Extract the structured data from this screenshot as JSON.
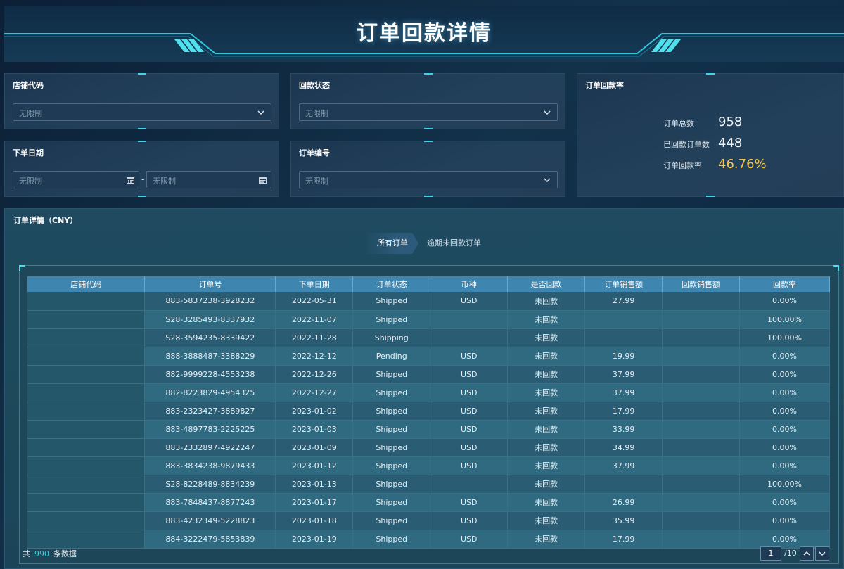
{
  "page": {
    "title": "订单回款详情"
  },
  "filters": {
    "store_code": {
      "label": "店铺代码",
      "placeholder": "无限制"
    },
    "payment_status": {
      "label": "回款状态",
      "placeholder": "无限制"
    },
    "order_date": {
      "label": "下单日期",
      "start_placeholder": "无限制",
      "end_placeholder": "无限制",
      "separator": "-"
    },
    "order_no": {
      "label": "订单编号",
      "placeholder": "无限制"
    }
  },
  "rate_panel": {
    "title": "订单回款率",
    "total_label": "订单总数",
    "total_value": "958",
    "paid_label": "已回款订单数",
    "paid_value": "448",
    "rate_label": "订单回款率",
    "rate_value": "46.76%"
  },
  "detail": {
    "title": "订单详情（CNY）",
    "tabs": [
      {
        "label": "所有订单"
      },
      {
        "label": "逾期未回款订单"
      }
    ],
    "columns": [
      "店铺代码",
      "订单号",
      "下单日期",
      "订单状态",
      "币种",
      "是否回款",
      "订单销售额",
      "回款销售额",
      "回款率"
    ],
    "rows": [
      {
        "store": "",
        "order_no": "883-5837238-3928232",
        "date": "2022-05-31",
        "status": "Shipped",
        "currency": "USD",
        "paid": "未回款",
        "sales": "27.99",
        "paid_sales": "",
        "rate": "0.00%"
      },
      {
        "store": "",
        "order_no": "S28-3285493-8337932",
        "date": "2022-11-07",
        "status": "Shipped",
        "currency": "",
        "paid": "未回款",
        "sales": "",
        "paid_sales": "",
        "rate": "100.00%"
      },
      {
        "store": "",
        "order_no": "S28-3594235-8339422",
        "date": "2022-11-28",
        "status": "Shipping",
        "currency": "",
        "paid": "未回款",
        "sales": "",
        "paid_sales": "",
        "rate": "100.00%"
      },
      {
        "store": "",
        "order_no": "888-3888487-3388229",
        "date": "2022-12-12",
        "status": "Pending",
        "currency": "USD",
        "paid": "未回款",
        "sales": "19.99",
        "paid_sales": "",
        "rate": "0.00%"
      },
      {
        "store": "",
        "order_no": "882-9999228-4553238",
        "date": "2022-12-26",
        "status": "Shipped",
        "currency": "USD",
        "paid": "未回款",
        "sales": "37.99",
        "paid_sales": "",
        "rate": "0.00%"
      },
      {
        "store": "",
        "order_no": "882-8223829-4954325",
        "date": "2022-12-27",
        "status": "Shipped",
        "currency": "USD",
        "paid": "未回款",
        "sales": "37.99",
        "paid_sales": "",
        "rate": "0.00%"
      },
      {
        "store": "",
        "order_no": "883-2323427-3889827",
        "date": "2023-01-02",
        "status": "Shipped",
        "currency": "USD",
        "paid": "未回款",
        "sales": "17.99",
        "paid_sales": "",
        "rate": "0.00%"
      },
      {
        "store": "",
        "order_no": "883-4897783-2225225",
        "date": "2023-01-03",
        "status": "Shipped",
        "currency": "USD",
        "paid": "未回款",
        "sales": "33.99",
        "paid_sales": "",
        "rate": "0.00%"
      },
      {
        "store": "",
        "order_no": "883-2332897-4922247",
        "date": "2023-01-09",
        "status": "Shipped",
        "currency": "USD",
        "paid": "未回款",
        "sales": "34.99",
        "paid_sales": "",
        "rate": "0.00%"
      },
      {
        "store": "",
        "order_no": "883-3834238-9879433",
        "date": "2023-01-12",
        "status": "Shipped",
        "currency": "USD",
        "paid": "未回款",
        "sales": "37.99",
        "paid_sales": "",
        "rate": "0.00%"
      },
      {
        "store": "",
        "order_no": "S28-8228489-8834239",
        "date": "2023-01-13",
        "status": "Shipped",
        "currency": "",
        "paid": "未回款",
        "sales": "",
        "paid_sales": "",
        "rate": "100.00%"
      },
      {
        "store": "",
        "order_no": "883-7848437-8877243",
        "date": "2023-01-17",
        "status": "Shipped",
        "currency": "USD",
        "paid": "未回款",
        "sales": "26.99",
        "paid_sales": "",
        "rate": "0.00%"
      },
      {
        "store": "",
        "order_no": "883-4232349-5228823",
        "date": "2023-01-18",
        "status": "Shipped",
        "currency": "USD",
        "paid": "未回款",
        "sales": "35.99",
        "paid_sales": "",
        "rate": "0.00%"
      },
      {
        "store": "",
        "order_no": "884-3222479-5853839",
        "date": "2023-01-19",
        "status": "Shipped",
        "currency": "USD",
        "paid": "未回款",
        "sales": "17.99",
        "paid_sales": "",
        "rate": "0.00%"
      }
    ]
  },
  "footer": {
    "total_prefix": "共",
    "total_count": "990",
    "total_suffix": "条数据"
  },
  "pager": {
    "current": "1",
    "total": "/10"
  },
  "colors": {
    "accent": "#3fd4e6",
    "rate_highlight": "#f4c453",
    "table_header": "#3e86b0"
  },
  "icons": {
    "select": "chevron-down-icon",
    "date": "calendar-icon",
    "prev": "chevron-up-icon",
    "next": "chevron-down-icon"
  }
}
